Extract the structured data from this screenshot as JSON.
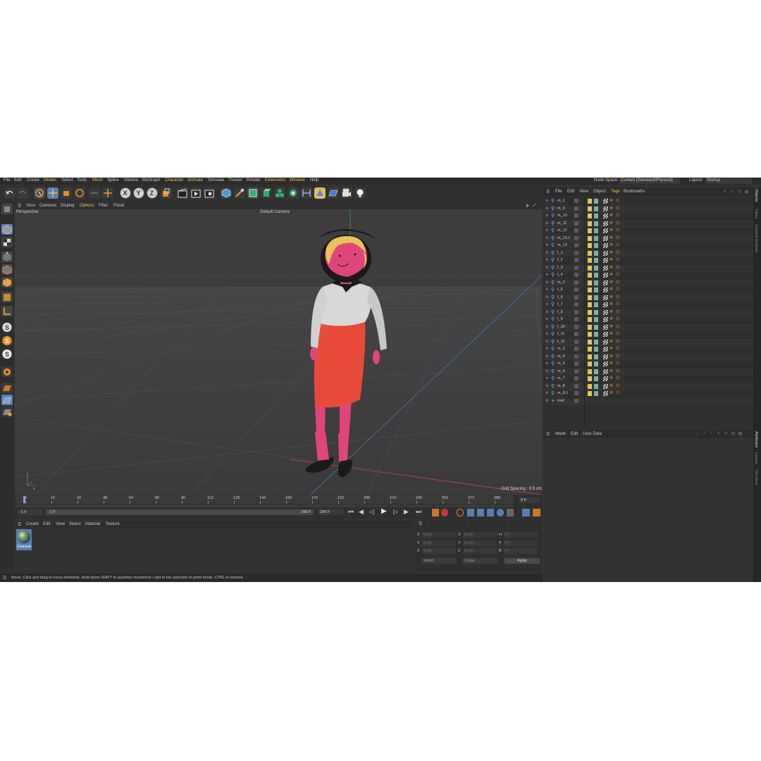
{
  "menubar": {
    "items": [
      "File",
      "Edit",
      "Create",
      "Modes",
      "Select",
      "Tools",
      "Mesh",
      "Spline",
      "Volume",
      "MoGraph",
      "Character",
      "Animate",
      "Simulate",
      "Tracker",
      "Render",
      "Extensions",
      "Window",
      "Help"
    ],
    "node_space_label": "Node Space:",
    "node_space_value": "Current (Standard/Physical)",
    "layout_label": "Layout:",
    "layout_value": "Startup"
  },
  "viewport": {
    "menu": [
      "View",
      "Cameras",
      "Display",
      "Options",
      "Filter",
      "Panel"
    ],
    "projection": "Perspective",
    "camera": "Default Camera",
    "grid_spacing": "Grid Spacing : 0.5 cm"
  },
  "objects": {
    "menu": [
      "File",
      "Edit",
      "View",
      "Object",
      "Tags",
      "Bookmarks"
    ],
    "items": [
      "m_1",
      "m_9",
      "m_10",
      "m_11",
      "m_12",
      "m_13.1",
      "m_13",
      "f_1",
      "f_2",
      "f_3",
      "f_4",
      "m_2",
      "f_5",
      "f_6",
      "f_7",
      "f_8",
      "f_9",
      "f_10",
      "f_11",
      "f_12",
      "m_3",
      "m_4",
      "m_5",
      "m_6",
      "m_7",
      "m_8",
      "m_8.1",
      "root"
    ]
  },
  "attributes": {
    "menu": [
      "Mode",
      "Edit",
      "User Data"
    ]
  },
  "right_tabs": [
    "Objects",
    "Takes",
    "Content Browser",
    "Attributes",
    "Layers",
    "Structure"
  ],
  "timeline": {
    "ticks": [
      "0",
      "16",
      "32",
      "48",
      "64",
      "80",
      "96",
      "112",
      "128",
      "144",
      "160",
      "176",
      "192",
      "208",
      "224",
      "240",
      "256",
      "272",
      "288"
    ],
    "current_frame": "0 F",
    "start_field": "-1 F",
    "start_field2": "-1 F",
    "end_field": "299 F",
    "end_field2": "299 F"
  },
  "material": {
    "menu": [
      "Create",
      "Edit",
      "View",
      "Select",
      "Material",
      "Texture"
    ],
    "name": "Characte"
  },
  "coordinates": {
    "header": [
      "--",
      "--",
      "--"
    ],
    "rows": [
      {
        "a": "X",
        "av": "0 cm",
        "b": "X",
        "bv": "0 cm",
        "c": "H",
        "cv": "0 °"
      },
      {
        "a": "Y",
        "av": "0 cm",
        "b": "Y",
        "bv": "0 cm",
        "c": "P",
        "cv": "0 °"
      },
      {
        "a": "Z",
        "av": "0 cm",
        "b": "Z",
        "bv": "0 cm",
        "c": "B",
        "cv": "0 °"
      }
    ],
    "space": "World",
    "mode": "Scale",
    "apply": "Apply"
  },
  "status": "Move: Click and drag to move elements. Hold down SHIFT to quantize movement / add to the selection in point mode, CTRL to remove.",
  "colors": {
    "accent": "#e8c25a",
    "selection": "#5a7fb5",
    "skirt": "#e84a3a",
    "skin": "#e0457a"
  }
}
